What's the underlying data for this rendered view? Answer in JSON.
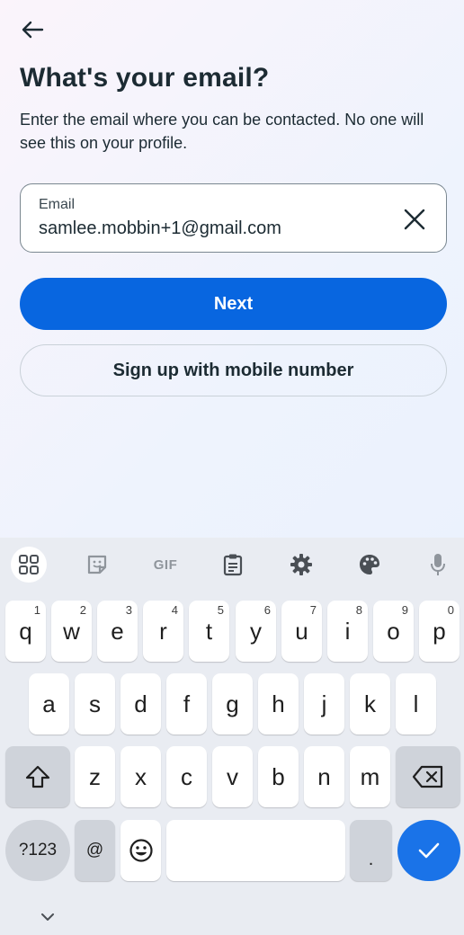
{
  "header": {
    "back_icon": "arrow-left-icon",
    "title": "What's your email?",
    "subtitle": "Enter the email where you can be contacted. No one will see this on your profile."
  },
  "email_field": {
    "label": "Email",
    "value": "samlee.mobbin+1@gmail.com",
    "clear_icon": "close-icon"
  },
  "buttons": {
    "next_label": "Next",
    "mobile_label": "Sign up with mobile number"
  },
  "keyboard": {
    "toolbar": {
      "apps_icon": "grid-icon",
      "sticker_icon": "sticker-icon",
      "gif_label": "GIF",
      "clipboard_icon": "clipboard-icon",
      "settings_icon": "gear-icon",
      "theme_icon": "palette-icon",
      "mic_icon": "microphone-icon"
    },
    "row1": [
      {
        "key": "q",
        "num": "1"
      },
      {
        "key": "w",
        "num": "2"
      },
      {
        "key": "e",
        "num": "3"
      },
      {
        "key": "r",
        "num": "4"
      },
      {
        "key": "t",
        "num": "5"
      },
      {
        "key": "y",
        "num": "6"
      },
      {
        "key": "u",
        "num": "7"
      },
      {
        "key": "i",
        "num": "8"
      },
      {
        "key": "o",
        "num": "9"
      },
      {
        "key": "p",
        "num": "0"
      }
    ],
    "row2": [
      "a",
      "s",
      "d",
      "f",
      "g",
      "h",
      "j",
      "k",
      "l"
    ],
    "row3": [
      "z",
      "x",
      "c",
      "v",
      "b",
      "n",
      "m"
    ],
    "symbols_label": "?123",
    "at_label": "@",
    "period_label": ".",
    "shift_icon": "shift-icon",
    "backspace_icon": "backspace-icon",
    "emoji_icon": "emoji-icon",
    "enter_icon": "checkmark-icon",
    "hide_icon": "chevron-down-icon"
  },
  "colors": {
    "primary": "#0866e0",
    "enter_key": "#1a73e8",
    "text": "#1c2b33"
  }
}
